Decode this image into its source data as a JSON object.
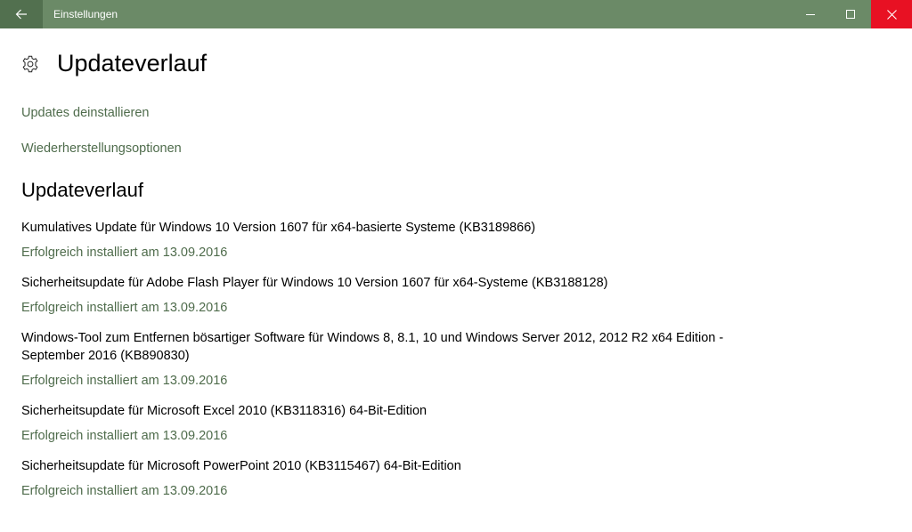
{
  "window": {
    "title": "Einstellungen",
    "accent_color": "#6b8a67",
    "close_color": "#e81123"
  },
  "titlebar": {
    "back_icon": "arrow-left-icon",
    "minimize_icon": "minimize-icon",
    "maximize_icon": "maximize-icon",
    "close_icon": "close-icon"
  },
  "header": {
    "icon": "gear-icon",
    "title": "Updateverlauf"
  },
  "links": {
    "uninstall": "Updates deinstallieren",
    "recovery": "Wiederherstellungsoptionen"
  },
  "history": {
    "title": "Updateverlauf",
    "items": [
      {
        "name": "Kumulatives Update für Windows 10 Version 1607 für x64-basierte Systeme (KB3189866)",
        "status": "Erfolgreich installiert am 13.09.2016"
      },
      {
        "name": "Sicherheitsupdate für Adobe Flash Player für Windows 10 Version 1607 für x64-Systeme (KB3188128)",
        "status": "Erfolgreich installiert am 13.09.2016"
      },
      {
        "name": "Windows-Tool zum Entfernen bösartiger Software für Windows 8, 8.1, 10 und Windows Server 2012, 2012 R2 x64 Edition - September 2016 (KB890830)",
        "status": "Erfolgreich installiert am 13.09.2016"
      },
      {
        "name": "Sicherheitsupdate für Microsoft Excel 2010 (KB3118316) 64-Bit-Edition",
        "status": "Erfolgreich installiert am 13.09.2016"
      },
      {
        "name": "Sicherheitsupdate für Microsoft PowerPoint 2010 (KB3115467) 64-Bit-Edition",
        "status": "Erfolgreich installiert am 13.09.2016"
      }
    ]
  }
}
